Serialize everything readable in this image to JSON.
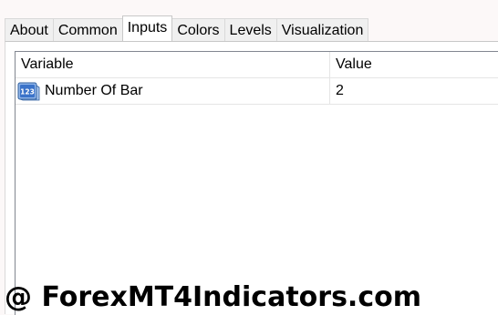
{
  "tabs": [
    {
      "label": "About",
      "active": false
    },
    {
      "label": "Common",
      "active": false
    },
    {
      "label": "Inputs",
      "active": true
    },
    {
      "label": "Colors",
      "active": false
    },
    {
      "label": "Levels",
      "active": false
    },
    {
      "label": "Visualization",
      "active": false
    }
  ],
  "inputs_table": {
    "headers": {
      "variable": "Variable",
      "value": "Value"
    },
    "rows": [
      {
        "icon": "numeric-123-icon",
        "icon_text": "123",
        "variable": "Number Of Bar",
        "value": "2"
      }
    ]
  },
  "watermark": "@ ForexMT4Indicators.com",
  "colors": {
    "background": "#fcf8f8",
    "tab_bg": "#f0f0f0",
    "active_tab_bg": "#ffffff",
    "icon_blue": "#3b73c9"
  }
}
